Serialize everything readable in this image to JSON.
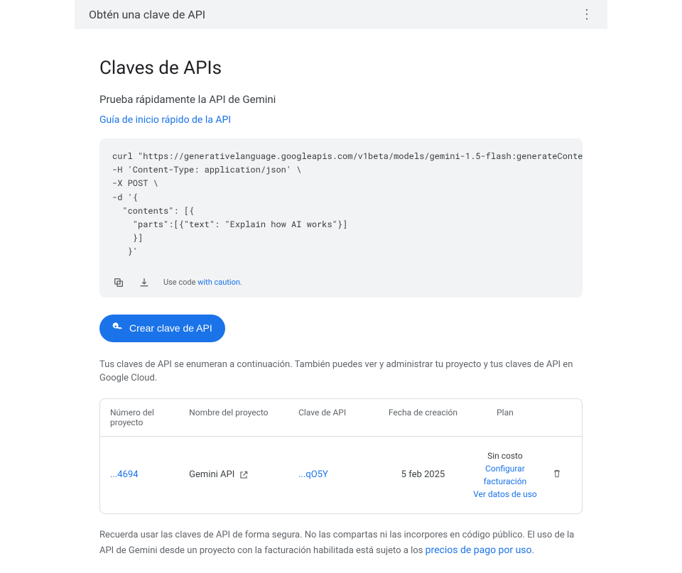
{
  "header": {
    "title": "Obtén una clave de API"
  },
  "main": {
    "title": "Claves de APIs",
    "subtitle": "Prueba rápidamente la API de Gemini",
    "quickstart_link": "Guía de inicio rápido de la API",
    "code": "curl \"https://generativelanguage.googleapis.com/v1beta/models/gemini-1.5-flash:generateContent?key=GEMINI_API_KEY\" \\\n-H 'Content-Type: application/json' \\\n-X POST \\\n-d '{\n  \"contents\": [{\n    \"parts\":[{\"text\": \"Explain how AI works\"}]\n    }]\n   }'",
    "caution_prefix": "Use code ",
    "caution_link": "with caution.",
    "create_button": "Crear clave de API",
    "desc": "Tus claves de API se enumeran a continuación. También puedes ver y administrar tu proyecto y tus claves de API en Google Cloud.",
    "table": {
      "headers": {
        "project_num": "Número del proyecto",
        "project_name": "Nombre del proyecto",
        "api_key": "Clave de API",
        "created": "Fecha de creación",
        "plan": "Plan"
      },
      "row": {
        "project_num": "...4694",
        "project_name": "Gemini API",
        "api_key": "...qO5Y",
        "created": "5 feb 2025",
        "plan_free": "Sin costo",
        "plan_billing": "Configurar facturación",
        "plan_usage": "Ver datos de uso"
      }
    },
    "footer_note_1": "Recuerda usar las claves de API de forma segura. No las compartas ni las incorpores en código público. El uso de la API de Gemini desde un proyecto con la facturación habilitada está sujeto a los ",
    "footer_link": "precios de pago por uso",
    "footer_note_2": "."
  }
}
